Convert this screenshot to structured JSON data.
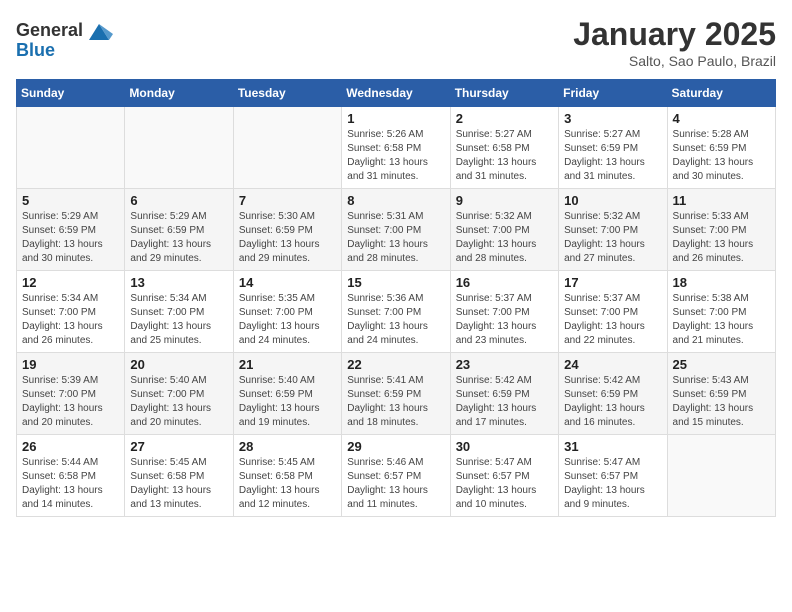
{
  "header": {
    "logo_general": "General",
    "logo_blue": "Blue",
    "month_title": "January 2025",
    "location": "Salto, Sao Paulo, Brazil"
  },
  "weekdays": [
    "Sunday",
    "Monday",
    "Tuesday",
    "Wednesday",
    "Thursday",
    "Friday",
    "Saturday"
  ],
  "weeks": [
    [
      {
        "day": "",
        "sunrise": "",
        "sunset": "",
        "daylight": ""
      },
      {
        "day": "",
        "sunrise": "",
        "sunset": "",
        "daylight": ""
      },
      {
        "day": "",
        "sunrise": "",
        "sunset": "",
        "daylight": ""
      },
      {
        "day": "1",
        "sunrise": "Sunrise: 5:26 AM",
        "sunset": "Sunset: 6:58 PM",
        "daylight": "Daylight: 13 hours and 31 minutes."
      },
      {
        "day": "2",
        "sunrise": "Sunrise: 5:27 AM",
        "sunset": "Sunset: 6:58 PM",
        "daylight": "Daylight: 13 hours and 31 minutes."
      },
      {
        "day": "3",
        "sunrise": "Sunrise: 5:27 AM",
        "sunset": "Sunset: 6:59 PM",
        "daylight": "Daylight: 13 hours and 31 minutes."
      },
      {
        "day": "4",
        "sunrise": "Sunrise: 5:28 AM",
        "sunset": "Sunset: 6:59 PM",
        "daylight": "Daylight: 13 hours and 30 minutes."
      }
    ],
    [
      {
        "day": "5",
        "sunrise": "Sunrise: 5:29 AM",
        "sunset": "Sunset: 6:59 PM",
        "daylight": "Daylight: 13 hours and 30 minutes."
      },
      {
        "day": "6",
        "sunrise": "Sunrise: 5:29 AM",
        "sunset": "Sunset: 6:59 PM",
        "daylight": "Daylight: 13 hours and 29 minutes."
      },
      {
        "day": "7",
        "sunrise": "Sunrise: 5:30 AM",
        "sunset": "Sunset: 6:59 PM",
        "daylight": "Daylight: 13 hours and 29 minutes."
      },
      {
        "day": "8",
        "sunrise": "Sunrise: 5:31 AM",
        "sunset": "Sunset: 7:00 PM",
        "daylight": "Daylight: 13 hours and 28 minutes."
      },
      {
        "day": "9",
        "sunrise": "Sunrise: 5:32 AM",
        "sunset": "Sunset: 7:00 PM",
        "daylight": "Daylight: 13 hours and 28 minutes."
      },
      {
        "day": "10",
        "sunrise": "Sunrise: 5:32 AM",
        "sunset": "Sunset: 7:00 PM",
        "daylight": "Daylight: 13 hours and 27 minutes."
      },
      {
        "day": "11",
        "sunrise": "Sunrise: 5:33 AM",
        "sunset": "Sunset: 7:00 PM",
        "daylight": "Daylight: 13 hours and 26 minutes."
      }
    ],
    [
      {
        "day": "12",
        "sunrise": "Sunrise: 5:34 AM",
        "sunset": "Sunset: 7:00 PM",
        "daylight": "Daylight: 13 hours and 26 minutes."
      },
      {
        "day": "13",
        "sunrise": "Sunrise: 5:34 AM",
        "sunset": "Sunset: 7:00 PM",
        "daylight": "Daylight: 13 hours and 25 minutes."
      },
      {
        "day": "14",
        "sunrise": "Sunrise: 5:35 AM",
        "sunset": "Sunset: 7:00 PM",
        "daylight": "Daylight: 13 hours and 24 minutes."
      },
      {
        "day": "15",
        "sunrise": "Sunrise: 5:36 AM",
        "sunset": "Sunset: 7:00 PM",
        "daylight": "Daylight: 13 hours and 24 minutes."
      },
      {
        "day": "16",
        "sunrise": "Sunrise: 5:37 AM",
        "sunset": "Sunset: 7:00 PM",
        "daylight": "Daylight: 13 hours and 23 minutes."
      },
      {
        "day": "17",
        "sunrise": "Sunrise: 5:37 AM",
        "sunset": "Sunset: 7:00 PM",
        "daylight": "Daylight: 13 hours and 22 minutes."
      },
      {
        "day": "18",
        "sunrise": "Sunrise: 5:38 AM",
        "sunset": "Sunset: 7:00 PM",
        "daylight": "Daylight: 13 hours and 21 minutes."
      }
    ],
    [
      {
        "day": "19",
        "sunrise": "Sunrise: 5:39 AM",
        "sunset": "Sunset: 7:00 PM",
        "daylight": "Daylight: 13 hours and 20 minutes."
      },
      {
        "day": "20",
        "sunrise": "Sunrise: 5:40 AM",
        "sunset": "Sunset: 7:00 PM",
        "daylight": "Daylight: 13 hours and 20 minutes."
      },
      {
        "day": "21",
        "sunrise": "Sunrise: 5:40 AM",
        "sunset": "Sunset: 6:59 PM",
        "daylight": "Daylight: 13 hours and 19 minutes."
      },
      {
        "day": "22",
        "sunrise": "Sunrise: 5:41 AM",
        "sunset": "Sunset: 6:59 PM",
        "daylight": "Daylight: 13 hours and 18 minutes."
      },
      {
        "day": "23",
        "sunrise": "Sunrise: 5:42 AM",
        "sunset": "Sunset: 6:59 PM",
        "daylight": "Daylight: 13 hours and 17 minutes."
      },
      {
        "day": "24",
        "sunrise": "Sunrise: 5:42 AM",
        "sunset": "Sunset: 6:59 PM",
        "daylight": "Daylight: 13 hours and 16 minutes."
      },
      {
        "day": "25",
        "sunrise": "Sunrise: 5:43 AM",
        "sunset": "Sunset: 6:59 PM",
        "daylight": "Daylight: 13 hours and 15 minutes."
      }
    ],
    [
      {
        "day": "26",
        "sunrise": "Sunrise: 5:44 AM",
        "sunset": "Sunset: 6:58 PM",
        "daylight": "Daylight: 13 hours and 14 minutes."
      },
      {
        "day": "27",
        "sunrise": "Sunrise: 5:45 AM",
        "sunset": "Sunset: 6:58 PM",
        "daylight": "Daylight: 13 hours and 13 minutes."
      },
      {
        "day": "28",
        "sunrise": "Sunrise: 5:45 AM",
        "sunset": "Sunset: 6:58 PM",
        "daylight": "Daylight: 13 hours and 12 minutes."
      },
      {
        "day": "29",
        "sunrise": "Sunrise: 5:46 AM",
        "sunset": "Sunset: 6:57 PM",
        "daylight": "Daylight: 13 hours and 11 minutes."
      },
      {
        "day": "30",
        "sunrise": "Sunrise: 5:47 AM",
        "sunset": "Sunset: 6:57 PM",
        "daylight": "Daylight: 13 hours and 10 minutes."
      },
      {
        "day": "31",
        "sunrise": "Sunrise: 5:47 AM",
        "sunset": "Sunset: 6:57 PM",
        "daylight": "Daylight: 13 hours and 9 minutes."
      },
      {
        "day": "",
        "sunrise": "",
        "sunset": "",
        "daylight": ""
      }
    ]
  ]
}
